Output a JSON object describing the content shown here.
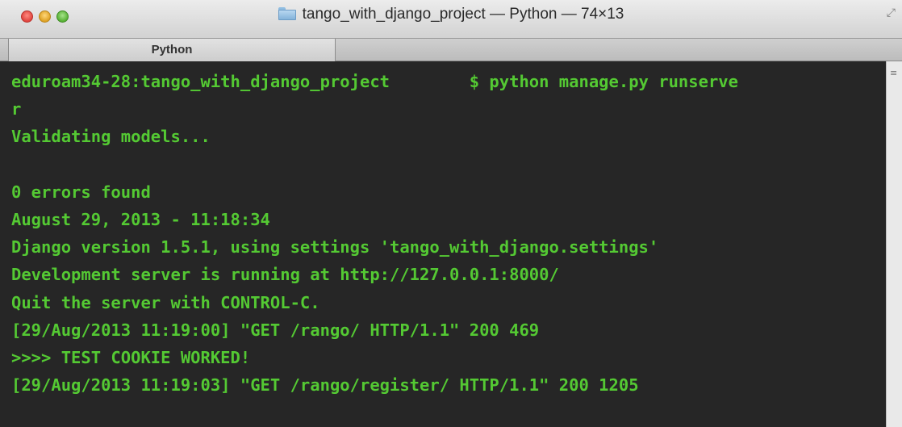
{
  "window": {
    "title": "tango_with_django_project — Python — 74×13",
    "tab_label": "Python",
    "icons": {
      "title_folder": "folder-icon",
      "fullscreen": "fullscreen-icon",
      "scroll": "scroll-indicator-icon"
    },
    "colors": {
      "terminal_text": "#54c933",
      "terminal_bg": "#262626"
    }
  },
  "terminal": {
    "lines": [
      "eduroam34-28:tango_with_django_project        $ python manage.py runserve",
      "r",
      "Validating models...",
      "",
      "0 errors found",
      "August 29, 2013 - 11:18:34",
      "Django version 1.5.1, using settings 'tango_with_django.settings'",
      "Development server is running at http://127.0.0.1:8000/",
      "Quit the server with CONTROL-C.",
      "[29/Aug/2013 11:19:00] \"GET /rango/ HTTP/1.1\" 200 469",
      ">>>> TEST COOKIE WORKED!",
      "[29/Aug/2013 11:19:03] \"GET /rango/register/ HTTP/1.1\" 200 1205",
      ""
    ]
  }
}
